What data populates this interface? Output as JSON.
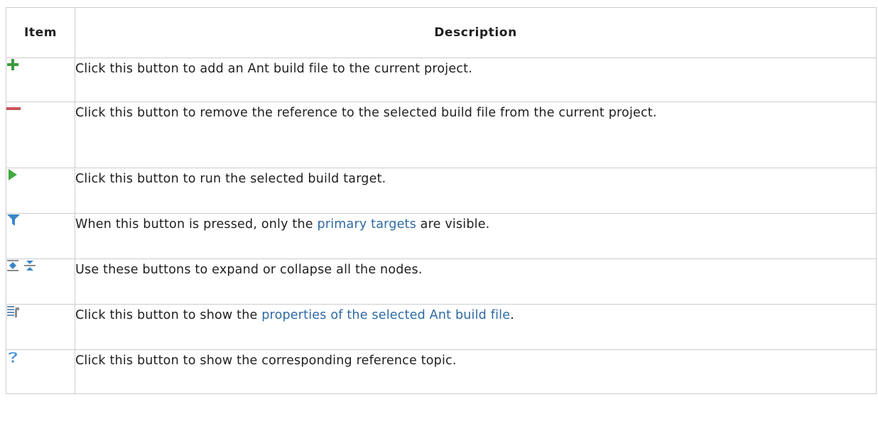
{
  "table": {
    "headers": {
      "item": "Item",
      "description": "Description"
    },
    "rows": [
      {
        "icon": "add-icon",
        "text": "Click this button to add an Ant build file to the current project."
      },
      {
        "icon": "remove-icon",
        "text": "Click this button to remove the reference to the selected build file from the current project."
      },
      {
        "icon": "run-icon",
        "text": "Click this button to run the selected build target."
      },
      {
        "icon": "filter-icon",
        "text_before": "When this button is pressed, only the ",
        "link": "primary targets",
        "text_after": " are visible."
      },
      {
        "icon": "expand-collapse-icons",
        "text": "Use these buttons to expand or collapse all the nodes."
      },
      {
        "icon": "properties-icon",
        "text_before": "Click this button to show the ",
        "link": "properties of the selected Ant build file",
        "text_after": "."
      },
      {
        "icon": "help-icon",
        "text": "Click this button to show the corresponding reference topic."
      }
    ]
  },
  "colors": {
    "border": "#cccccc",
    "link": "#2f6aa3",
    "add_green": "#3d9a3d",
    "remove_red": "#c9555a",
    "run_green": "#3faa3f",
    "filter_blue": "#3a86c8",
    "help_blue": "#3c8fd6"
  }
}
